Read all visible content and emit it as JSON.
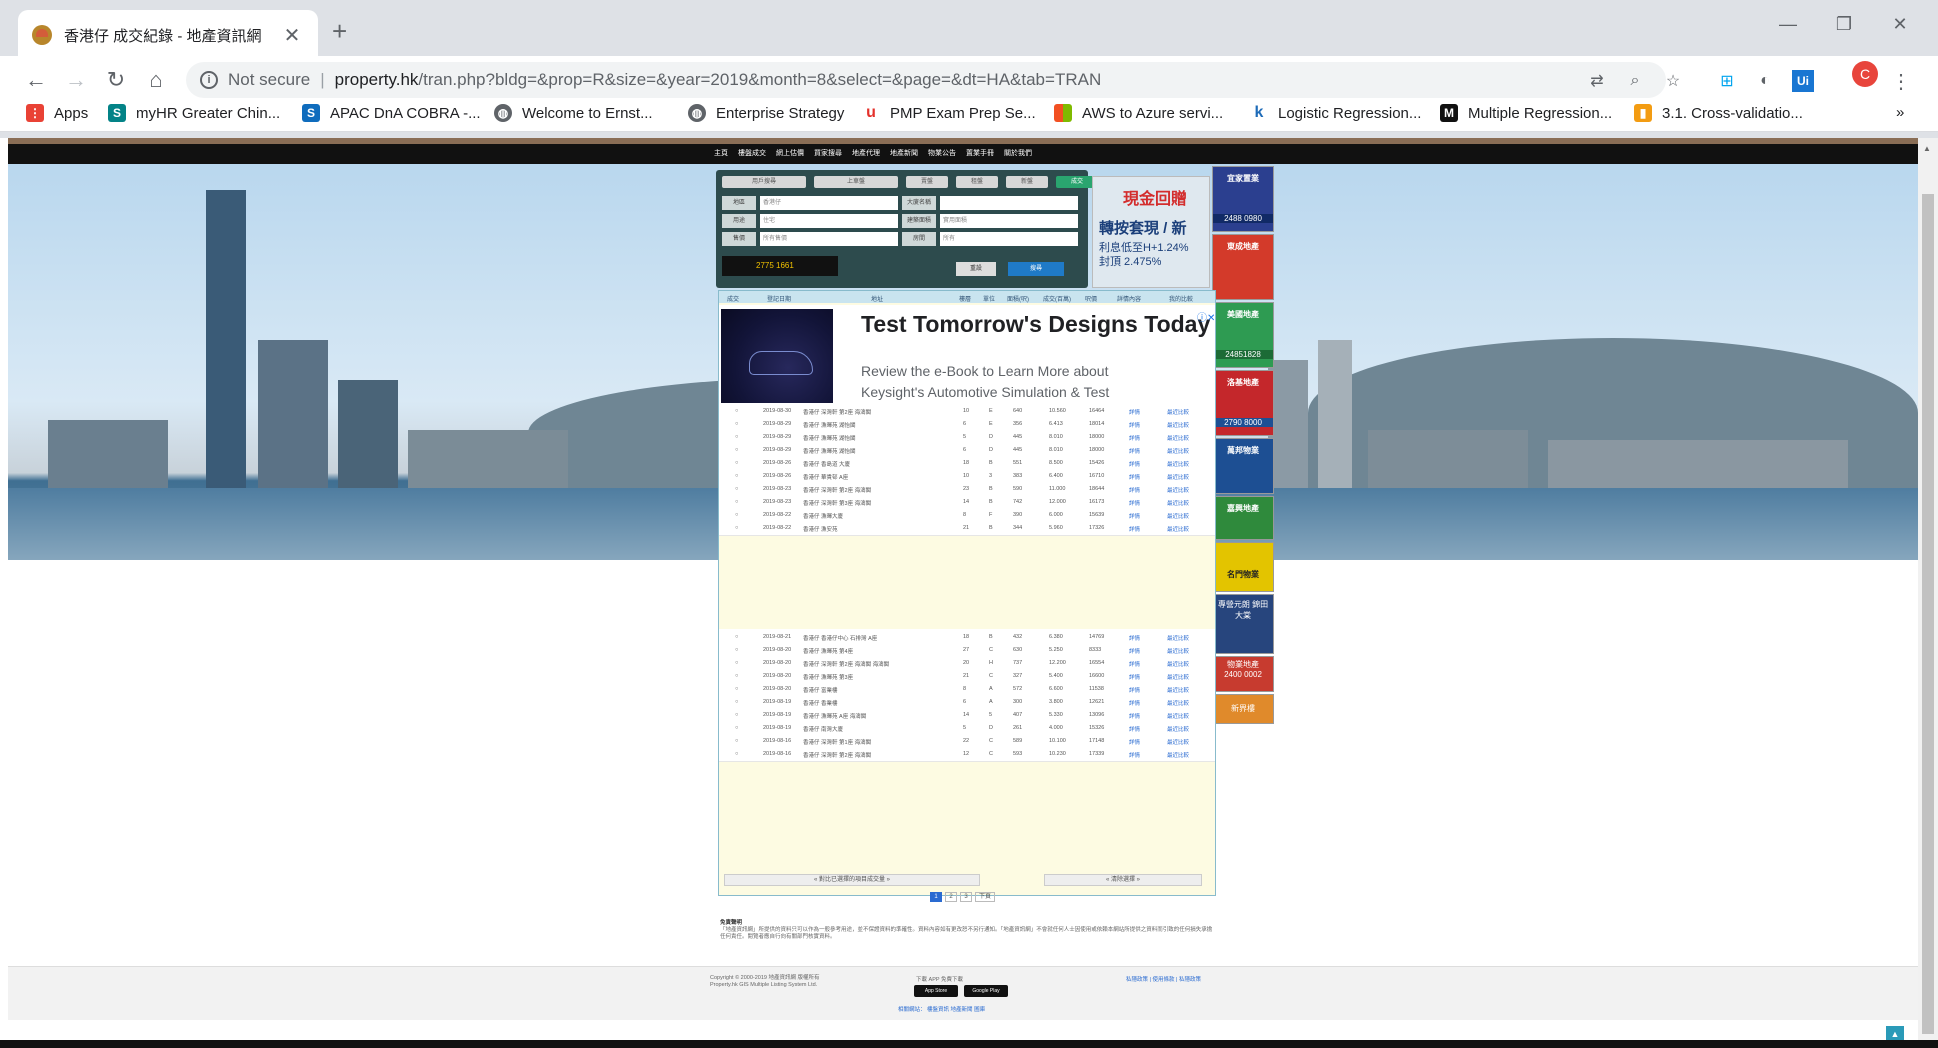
{
  "browser": {
    "tab_title": "香港仔 成交紀錄 - 地產資訊網",
    "tab_close": "✕",
    "new_tab": "+",
    "url_secure": "Not secure",
    "url_host": "property.hk",
    "url_path": "/tran.php?bldg=&prop=R&size=&year=2019&month=8&select=&page=&dt=HA&tab=TRAN",
    "avatar_letter": "C",
    "bookmarks": [
      {
        "label": "Apps",
        "icon": "apps-icon",
        "color": "#e94235"
      },
      {
        "label": "myHR Greater Chin...",
        "icon": "sharepoint-icon",
        "color": "#038387"
      },
      {
        "label": "APAC DnA COBRA -...",
        "icon": "sharepoint-icon",
        "color": "#0f6cbd"
      },
      {
        "label": "Welcome to Ernst...",
        "icon": "globe-icon",
        "color": "#5f6368"
      },
      {
        "label": "Enterprise Strategy",
        "icon": "globe-icon",
        "color": "#5f6368"
      },
      {
        "label": "PMP Exam Prep Se...",
        "icon": "udemy-icon",
        "color": "#e4312b"
      },
      {
        "label": "AWS to Azure servi...",
        "icon": "microsoft-icon",
        "color": "#f25022"
      },
      {
        "label": "Logistic Regression...",
        "icon": "k-icon",
        "color": "#1e6bb8"
      },
      {
        "label": "Multiple Regression...",
        "icon": "medium-icon",
        "color": "#111111"
      },
      {
        "label": "3.1. Cross-validatio...",
        "icon": "chart-icon",
        "color": "#f39c12"
      }
    ],
    "more_bookmarks": "»"
  },
  "site": {
    "top_links": [
      "主頁",
      "樓盤成交",
      "網上估價",
      "買家搜尋",
      "地產代理",
      "地產新聞",
      "物業公告",
      "置業手冊",
      "關於我們"
    ],
    "search_tabs": [
      "用戶搜尋",
      "上車盤",
      "賣盤",
      "租盤",
      "新盤",
      "成交"
    ],
    "search_fields": {
      "district_label": "地區",
      "district_value": "香港仔",
      "building_label": "大廈名稱",
      "type_label": "用途",
      "type_value": "住宅",
      "area_label": "建築面積",
      "area_value": "實用面積",
      "price_label": "售價",
      "price_value": "所有售價",
      "room_label": "房間",
      "room_value": "所有"
    },
    "search_buttons": [
      "重設",
      "搜尋"
    ],
    "agent_phone": "2775 1661",
    "side_ad": {
      "title": "現金回贈",
      "line1": "轉按套現 / 新",
      "line2": "利息低至H+1.24%",
      "line3": "封頂 2.475%"
    },
    "right_ads": [
      {
        "name": "宜家置業",
        "phone": "2488 0980",
        "color": "#2b3f8f"
      },
      {
        "name": "東成地產",
        "phone": "",
        "color": "#d33a2a"
      },
      {
        "name": "美國地產",
        "phone": "24851828",
        "color": "#2e9b52"
      },
      {
        "name": "洛基地產",
        "phone": "2790 8000",
        "color": "#c4272b"
      },
      {
        "name": "萬邦物業",
        "phone": "",
        "color": "#1d4f93"
      },
      {
        "name": "嘉興地產",
        "phone": "",
        "color": "#2f8a3c"
      },
      {
        "name": "名門物業",
        "phone": "",
        "color": "#e3c400"
      },
      {
        "name": "專營元朗 錦田 大棠",
        "phone": "",
        "color": "#27457d"
      },
      {
        "name": "物業地產",
        "phone": "2400 0002",
        "color": "#c73b2f"
      },
      {
        "name": "新界樓",
        "phone": "",
        "color": "#e08a2b"
      }
    ],
    "table_headers": [
      "成交",
      "登記日期",
      "地址",
      "樓層",
      "單位",
      "面積(呎)",
      "成交(百萬)",
      "呎價",
      "詳情內容",
      "我的比較"
    ],
    "ad": {
      "headline": "Test Tomorrow's Designs Today",
      "body": "Review the e-Book to Learn More about Keysight's Automotive Simulation & Test Solutions.",
      "close": "ⓘ✕"
    },
    "rows_top": [
      {
        "date": "2019-08-30",
        "addr": "香港仔 深灣軒 第2座 海濤閣",
        "floor": "10",
        "unit": "E",
        "area": "640",
        "price": "10.560",
        "psf": "16464",
        "detail": "詳情",
        "cmp": "最近比較"
      },
      {
        "date": "2019-08-29",
        "addr": "香港仔 漁暉苑 湖怡閣",
        "floor": "6",
        "unit": "E",
        "area": "356",
        "price": "6.413",
        "psf": "18014",
        "detail": "詳情",
        "cmp": "最近比較"
      },
      {
        "date": "2019-08-29",
        "addr": "香港仔 漁暉苑 湖怡閣",
        "floor": "5",
        "unit": "D",
        "area": "445",
        "price": "8.010",
        "psf": "18000",
        "detail": "詳情",
        "cmp": "最近比較"
      },
      {
        "date": "2019-08-29",
        "addr": "香港仔 漁暉苑 湖怡閣",
        "floor": "6",
        "unit": "D",
        "area": "445",
        "price": "8.010",
        "psf": "18000",
        "detail": "詳情",
        "cmp": "最近比較"
      },
      {
        "date": "2019-08-26",
        "addr": "香港仔 香島道 大廈",
        "floor": "18",
        "unit": "B",
        "area": "551",
        "price": "8.500",
        "psf": "15426",
        "detail": "詳情",
        "cmp": "最近比較"
      },
      {
        "date": "2019-08-26",
        "addr": "香港仔 華貴邨 A座",
        "floor": "10",
        "unit": "3",
        "area": "383",
        "price": "6.400",
        "psf": "16710",
        "detail": "詳情",
        "cmp": "最近比較"
      },
      {
        "date": "2019-08-23",
        "addr": "香港仔 深灣軒 第2座 海濤閣",
        "floor": "23",
        "unit": "B",
        "area": "590",
        "price": "11.000",
        "psf": "18644",
        "detail": "詳情",
        "cmp": "最近比較"
      },
      {
        "date": "2019-08-23",
        "addr": "香港仔 深灣軒 第3座 海濤閣",
        "floor": "14",
        "unit": "B",
        "area": "742",
        "price": "12.000",
        "psf": "16173",
        "detail": "詳情",
        "cmp": "最近比較"
      },
      {
        "date": "2019-08-22",
        "addr": "香港仔 漁暉大廈",
        "floor": "8",
        "unit": "F",
        "area": "390",
        "price": "6.000",
        "psf": "15639",
        "detail": "詳情",
        "cmp": "最近比較"
      },
      {
        "date": "2019-08-22",
        "addr": "香港仔 漁安苑",
        "floor": "21",
        "unit": "B",
        "area": "344",
        "price": "5.960",
        "psf": "17326",
        "detail": "詳情",
        "cmp": "最近比較"
      }
    ],
    "rows_bottom": [
      {
        "date": "2019-08-21",
        "addr": "香港仔 香港仔中心 石排灣 A座",
        "floor": "18",
        "unit": "B",
        "area": "432",
        "price": "6.380",
        "psf": "14769",
        "detail": "詳情",
        "cmp": "最近比較"
      },
      {
        "date": "2019-08-20",
        "addr": "香港仔 漁暉苑 第4座",
        "floor": "27",
        "unit": "C",
        "area": "630",
        "price": "5.250",
        "psf": "8333",
        "detail": "詳情",
        "cmp": "最近比較"
      },
      {
        "date": "2019-08-20",
        "addr": "香港仔 深灣軒 第2座 海濤閣 海濤閣",
        "floor": "20",
        "unit": "H",
        "area": "737",
        "price": "12.200",
        "psf": "16554",
        "detail": "詳情",
        "cmp": "最近比較"
      },
      {
        "date": "2019-08-20",
        "addr": "香港仔 漁暉苑 第3座",
        "floor": "21",
        "unit": "C",
        "area": "327",
        "price": "5.400",
        "psf": "16600",
        "detail": "詳情",
        "cmp": "最近比較"
      },
      {
        "date": "2019-08-20",
        "addr": "香港仔 富業樓",
        "floor": "8",
        "unit": "A",
        "area": "572",
        "price": "6.600",
        "psf": "11538",
        "detail": "詳情",
        "cmp": "最近比較"
      },
      {
        "date": "2019-08-19",
        "addr": "香港仔 香業樓",
        "floor": "6",
        "unit": "A",
        "area": "300",
        "price": "3.800",
        "psf": "12621",
        "detail": "詳情",
        "cmp": "最近比較"
      },
      {
        "date": "2019-08-19",
        "addr": "香港仔 漁暉苑 A座 海濤閣",
        "floor": "14",
        "unit": "5",
        "area": "407",
        "price": "5.330",
        "psf": "13096",
        "detail": "詳情",
        "cmp": "最近比較"
      },
      {
        "date": "2019-08-19",
        "addr": "香港仔 南灣大廈",
        "floor": "5",
        "unit": "D",
        "area": "261",
        "price": "4.000",
        "psf": "15326",
        "detail": "詳情",
        "cmp": "最近比較"
      },
      {
        "date": "2019-08-16",
        "addr": "香港仔 深灣軒 第1座 海濤閣",
        "floor": "22",
        "unit": "C",
        "area": "589",
        "price": "10.100",
        "psf": "17148",
        "detail": "詳情",
        "cmp": "最近比較"
      },
      {
        "date": "2019-08-16",
        "addr": "香港仔 深灣軒 第2座 海濤閣",
        "floor": "12",
        "unit": "C",
        "area": "593",
        "price": "10.230",
        "psf": "17339",
        "detail": "詳情",
        "cmp": "最近比較"
      }
    ],
    "prev_btn": "« 對比已選擇的項目成交量 »",
    "next_btn": "« 清除選擇 »",
    "pages": [
      "1",
      "2",
      "3",
      "下頁"
    ],
    "disclaimer_title": "免責聲明",
    "disclaimer_body": "「地產資訊網」所提供的資料只可以作為一般參考用途，並不保證資料的準確性。資料內容如有更改恕不另行通知。「地產資訊網」不會就任何人士因使用或依賴本網站所提供之資料而引致的任何損失承擔任何責任。閱覽者應自行向有關部門核實資料。",
    "footer_copyright": "Copyright © 2000-2019 地產資訊網 版權所有",
    "footer_sub": "Property.hk GIS Multiple Listing System Ltd.",
    "footer_app": "下載 APP 免費下載",
    "footer_links": "私隱政策 | 使用條款 | 私隱政策",
    "footer_bottom_links": "相關網站：  樓盤資訊   地產新聞   圖庫"
  }
}
